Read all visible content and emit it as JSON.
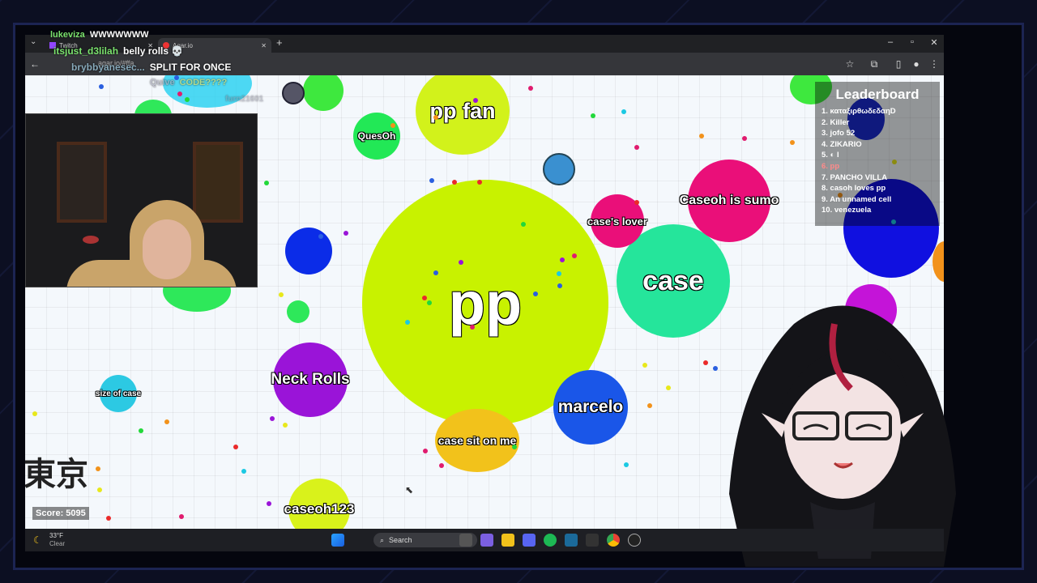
{
  "browser": {
    "tabs": [
      {
        "label": "Twitch"
      },
      {
        "label": "Agar.io"
      }
    ],
    "url": "agar.io/#ffa"
  },
  "chat": [
    {
      "user": "lukeviza",
      "message": "WWWWWWW"
    },
    {
      "user": "itsjust_d3lilah",
      "message": "belly rolls 💀"
    },
    {
      "user": "brybbyanesec...",
      "message": "SPLIT FOR ONCE"
    },
    {
      "user": "Quive",
      "message": "CODE????"
    },
    {
      "user": "furn21601",
      "message": ""
    }
  ],
  "cells": [
    {
      "name": "pp",
      "color": "#c8f200"
    },
    {
      "name": "pp fan",
      "color": "#d2f21b"
    },
    {
      "name": "case",
      "color": "#25e59b"
    },
    {
      "name": "Caseoh is sumo",
      "color": "#ea0f79"
    },
    {
      "name": "case's lover",
      "color": "#ea0f79"
    },
    {
      "name": "Neck Rolls",
      "color": "#9a14d8"
    },
    {
      "name": "marcelo",
      "color": "#1a56e8"
    },
    {
      "name": "case sit on me",
      "color": "#f2c21b"
    },
    {
      "name": "caseoh123",
      "color": "#d9f21b"
    },
    {
      "name": "QuesOh",
      "color": "#22e856"
    },
    {
      "name": "size of case",
      "color": "#2cc9e3"
    },
    {
      "name": "東京",
      "color": ""
    }
  ],
  "leaderboard": {
    "title": "Leaderboard",
    "items": [
      "1. καταξιρθωδεδαηD",
      "2. Killer",
      "3. jofo 52",
      "4. ZIKARIO",
      "5. ◐ l",
      "6. pp",
      "7. PANCHO VILLA",
      "8. casoh loves pp",
      "9. An unnamed cell",
      "10. venezuela"
    ]
  },
  "score": "Score: 5095",
  "taskbar": {
    "weather_temp": "33°F",
    "weather_desc": "Clear",
    "search_placeholder": "Search"
  }
}
